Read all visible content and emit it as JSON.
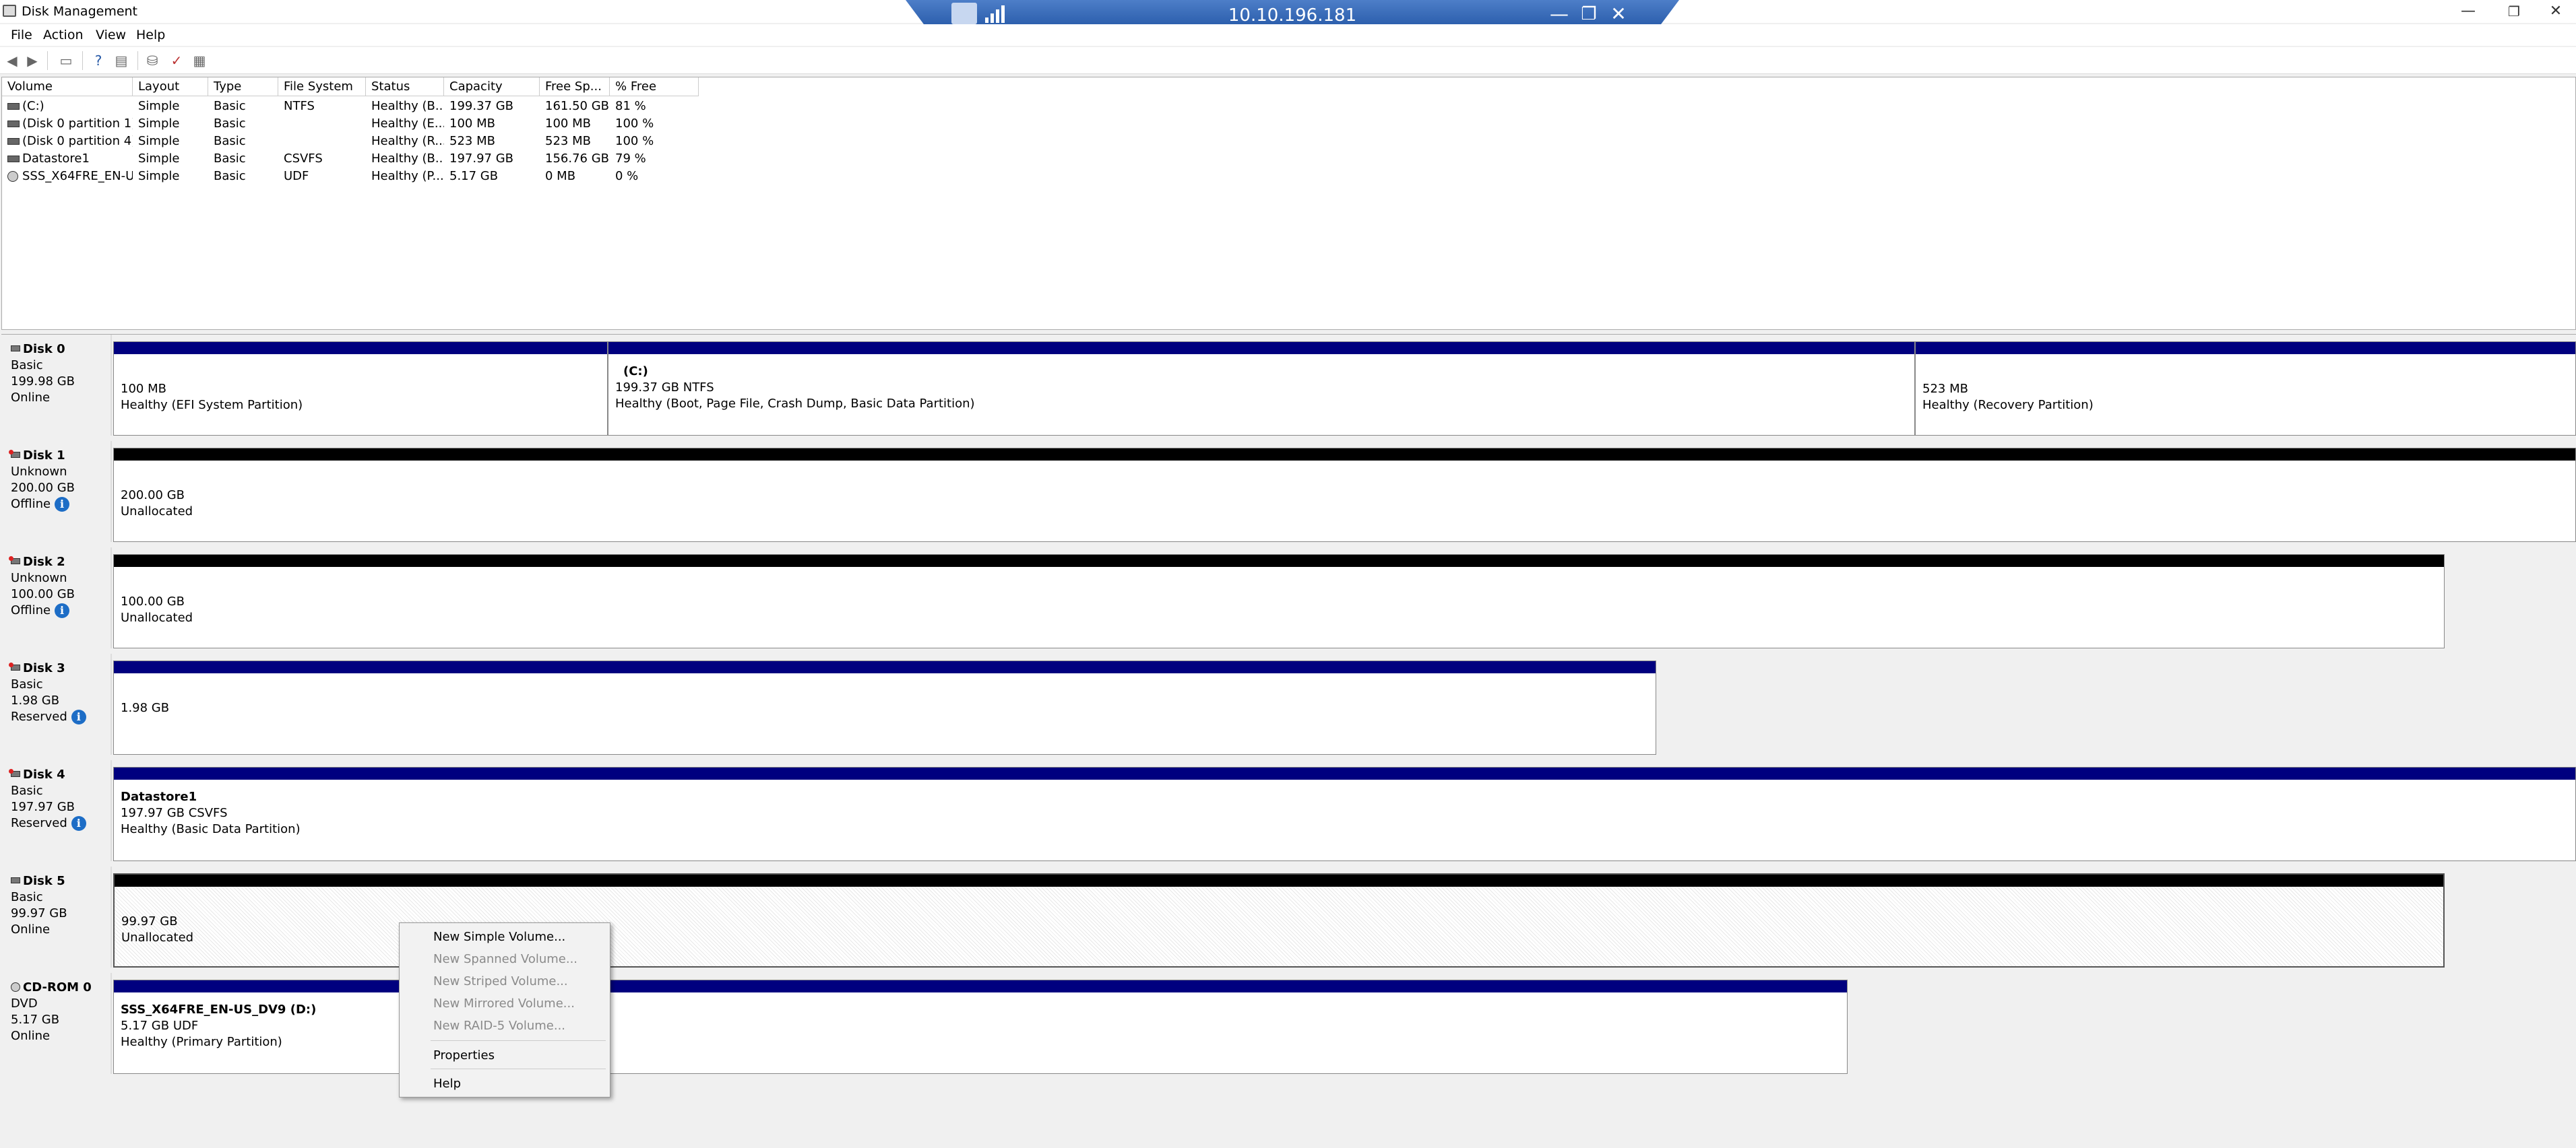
{
  "window": {
    "title": "Disk Management"
  },
  "rdp": {
    "host": "10.10.196.181",
    "minimize": "—",
    "restore": "❐",
    "close": "✕"
  },
  "window_controls": {
    "minimize": "—",
    "restore": "❐",
    "close": "✕"
  },
  "menu": [
    "File",
    "Action",
    "View",
    "Help"
  ],
  "toolbar_icons": [
    "back-icon",
    "forward-icon",
    "show-hide-icon",
    "help-icon",
    "properties-icon",
    "connect-icon",
    "checklist-icon",
    "settings-icon"
  ],
  "volume_list": {
    "columns": [
      "Volume",
      "Layout",
      "Type",
      "File System",
      "Status",
      "Capacity",
      "Free Sp...",
      "% Free"
    ],
    "rows": [
      [
        "(C:)",
        "Simple",
        "Basic",
        "NTFS",
        "Healthy (B...",
        "199.37 GB",
        "161.50 GB",
        "81 %"
      ],
      [
        "(Disk 0 partition 1)",
        "Simple",
        "Basic",
        "",
        "Healthy (E...",
        "100 MB",
        "100 MB",
        "100 %"
      ],
      [
        "(Disk 0 partition 4)",
        "Simple",
        "Basic",
        "",
        "Healthy (R...",
        "523 MB",
        "523 MB",
        "100 %"
      ],
      [
        "Datastore1",
        "Simple",
        "Basic",
        "CSVFS",
        "Healthy (B...",
        "197.97 GB",
        "156.76 GB",
        "79 %"
      ],
      [
        "SSS_X64FRE_EN-U...",
        "Simple",
        "Basic",
        "UDF",
        "Healthy (P...",
        "5.17 GB",
        "0 MB",
        "0 %"
      ]
    ]
  },
  "disks": [
    {
      "name": "Disk 0",
      "type": "Basic",
      "size": "199.98 GB",
      "status": "Online",
      "info": "",
      "partitions": [
        {
          "title": "",
          "line1": "100 MB",
          "line2": "Healthy (EFI System Partition)"
        },
        {
          "title": "(C:)",
          "line1": "199.37 GB NTFS",
          "line2": "Healthy (Boot, Page File, Crash Dump, Basic Data Partition)"
        },
        {
          "title": "",
          "line1": "523 MB",
          "line2": "Healthy (Recovery Partition)"
        }
      ]
    },
    {
      "name": "Disk 1",
      "type": "Unknown",
      "size": "200.00 GB",
      "status": "Offline",
      "info": "i",
      "partitions": [
        {
          "title": "",
          "line1": "200.00 GB",
          "line2": "Unallocated"
        }
      ]
    },
    {
      "name": "Disk 2",
      "type": "Unknown",
      "size": "100.00 GB",
      "status": "Offline",
      "info": "i",
      "partitions": [
        {
          "title": "",
          "line1": "100.00 GB",
          "line2": "Unallocated"
        }
      ]
    },
    {
      "name": "Disk 3",
      "type": "Basic",
      "size": "1.98 GB",
      "status": "Reserved",
      "info": "i",
      "partitions": [
        {
          "title": "",
          "line1": "1.98 GB",
          "line2": ""
        }
      ]
    },
    {
      "name": "Disk 4",
      "type": "Basic",
      "size": "197.97 GB",
      "status": "Reserved",
      "info": "i",
      "partitions": [
        {
          "title": "Datastore1",
          "line1": "197.97 GB CSVFS",
          "line2": "Healthy (Basic Data Partition)"
        }
      ]
    },
    {
      "name": "Disk 5",
      "type": "Basic",
      "size": "99.97 GB",
      "status": "Online",
      "info": "",
      "partitions": [
        {
          "title": "",
          "line1": "99.97 GB",
          "line2": "Unallocated"
        }
      ]
    },
    {
      "name": "CD-ROM 0",
      "type": "DVD",
      "size": "5.17 GB",
      "status": "Online",
      "info": "",
      "partitions": [
        {
          "title": "SSS_X64FRE_EN-US_DV9  (D:)",
          "line1": "5.17 GB UDF",
          "line2": "Healthy (Primary Partition)"
        }
      ]
    }
  ],
  "context_menu": {
    "items": [
      {
        "label": "New Simple Volume...",
        "enabled": true
      },
      {
        "label": "New Spanned Volume...",
        "enabled": false
      },
      {
        "label": "New Striped Volume...",
        "enabled": false
      },
      {
        "label": "New Mirrored Volume...",
        "enabled": false
      },
      {
        "label": "New RAID-5 Volume...",
        "enabled": false
      },
      {
        "label": "Properties",
        "enabled": true
      },
      {
        "label": "Help",
        "enabled": true
      }
    ]
  },
  "colors": {
    "primary_bar": "#00007f",
    "unallocated_bar": "#000000",
    "rdp_bar": "#2457a6",
    "info_badge": "#1d6dc6"
  }
}
